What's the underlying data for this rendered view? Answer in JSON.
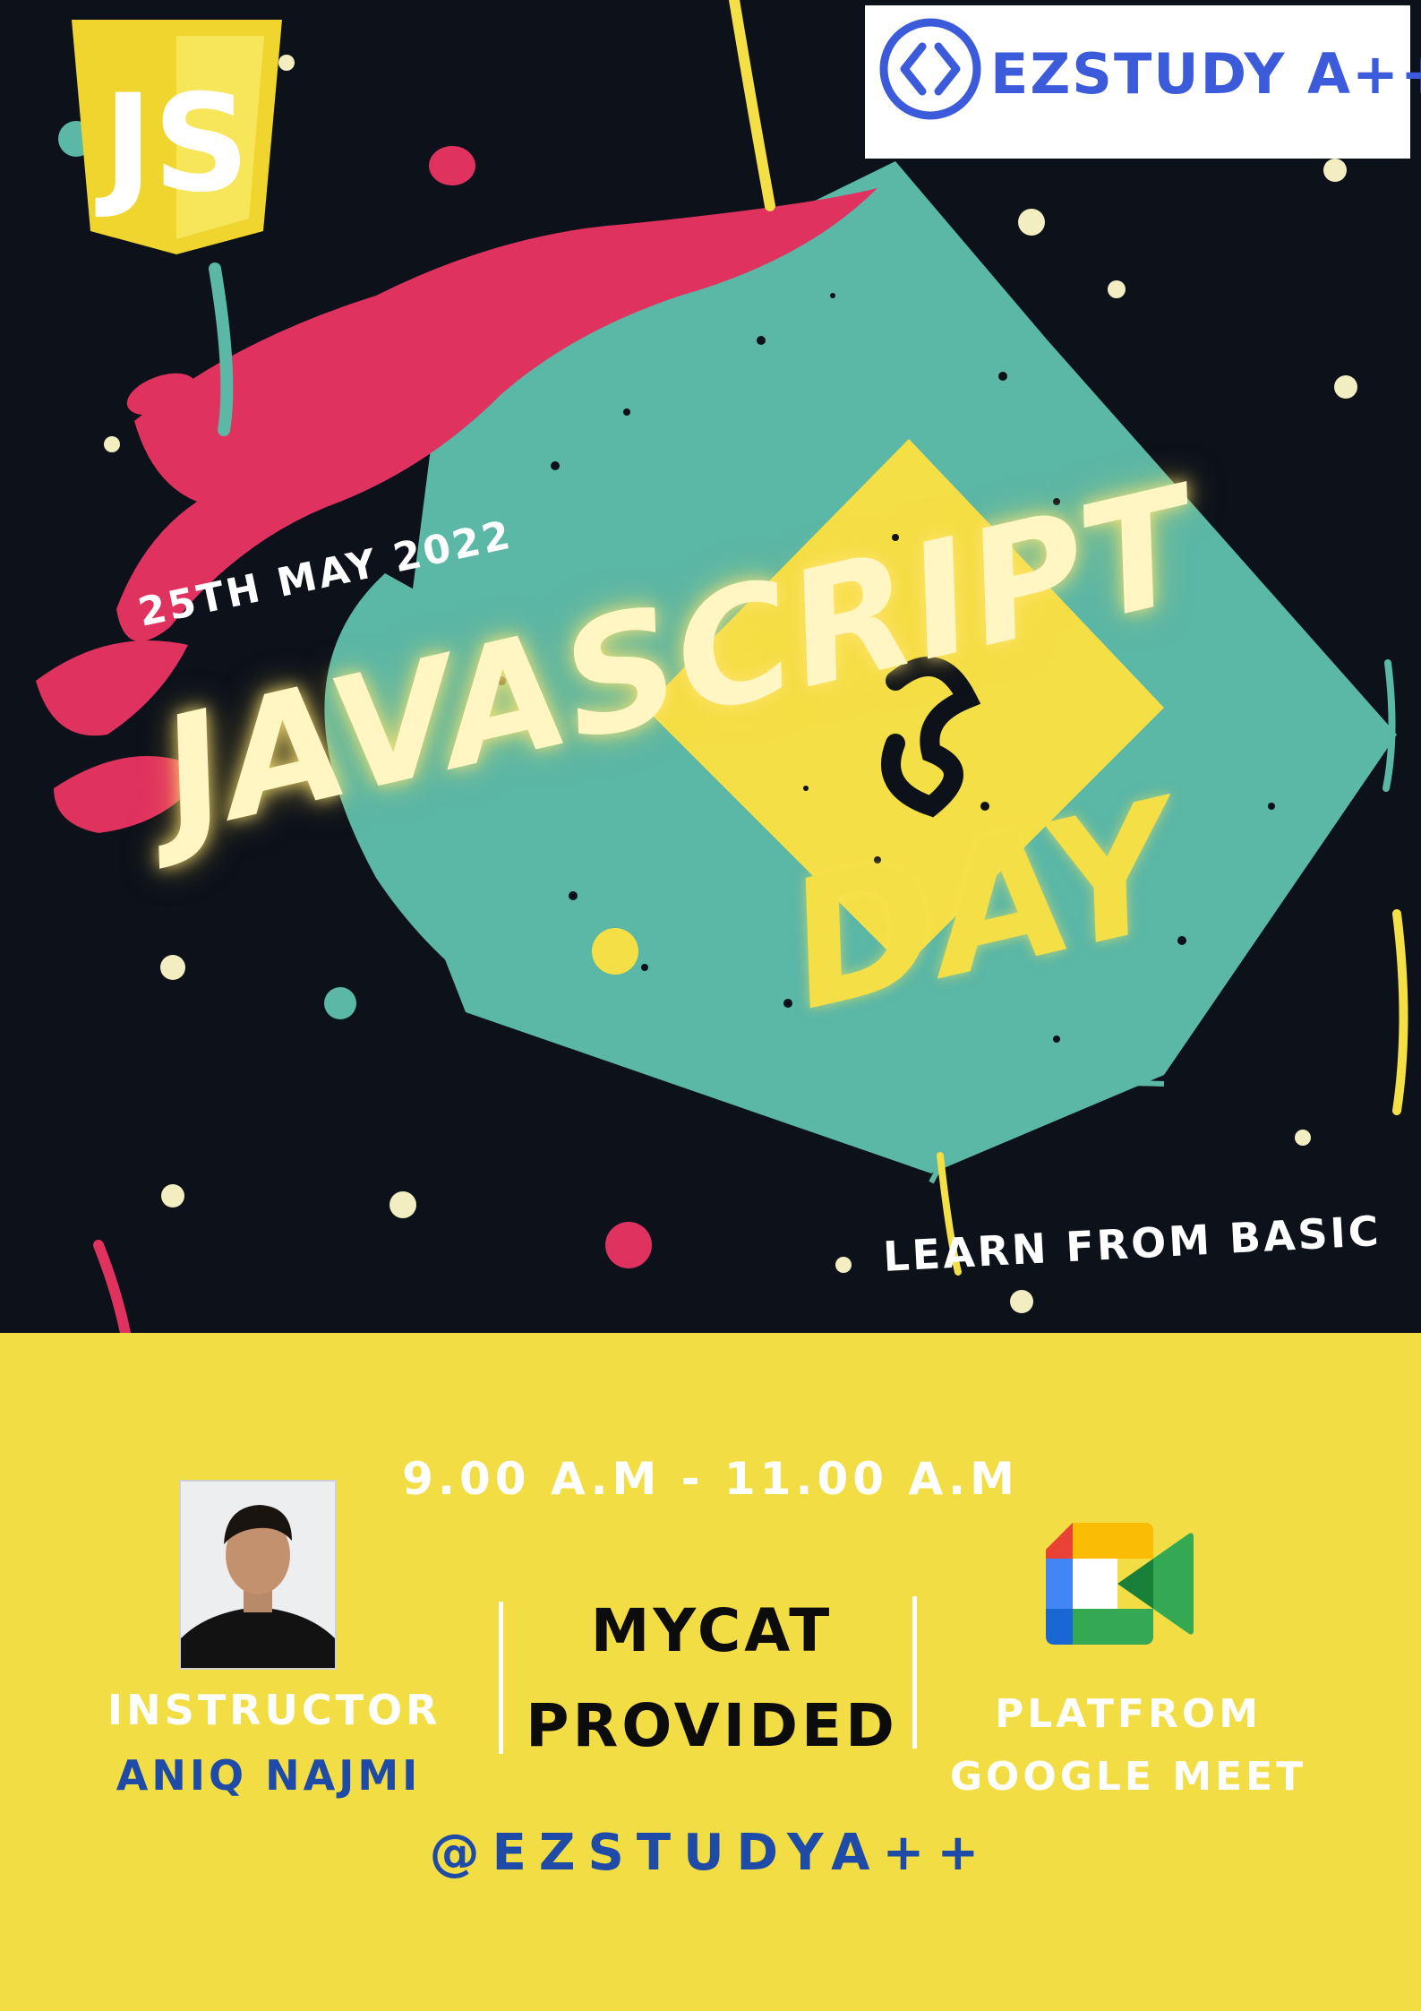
{
  "header": {
    "logo_text": "EZSTUDY A++"
  },
  "hero": {
    "date": "25TH MAY 2022",
    "title_line1": "JAVASCRIPT",
    "title_line2": "DAY",
    "tagline": "LEARN FROM BASIC",
    "badge_text": "JS"
  },
  "details": {
    "time": "9.00 A.M - 11.00 A.M",
    "instructor_label": "INSTRUCTOR",
    "instructor_name": "ANIQ NAJMI",
    "center_line1": "MYCAT",
    "center_line2": "PROVIDED",
    "platform_line1": "PLATFROM",
    "platform_line2": "GOOGLE MEET",
    "handle": "@EZSTUDYA++"
  },
  "colors": {
    "background_dark": "#0c111a",
    "panel_yellow": "#f3dd45",
    "teal": "#5bb7a6",
    "pink": "#e0325f",
    "title_glow": "#fff6c4",
    "brand_blue": "#1e4aa8"
  },
  "icons": [
    "javascript-shield-icon",
    "code-brackets-logo-icon",
    "google-meet-icon"
  ]
}
